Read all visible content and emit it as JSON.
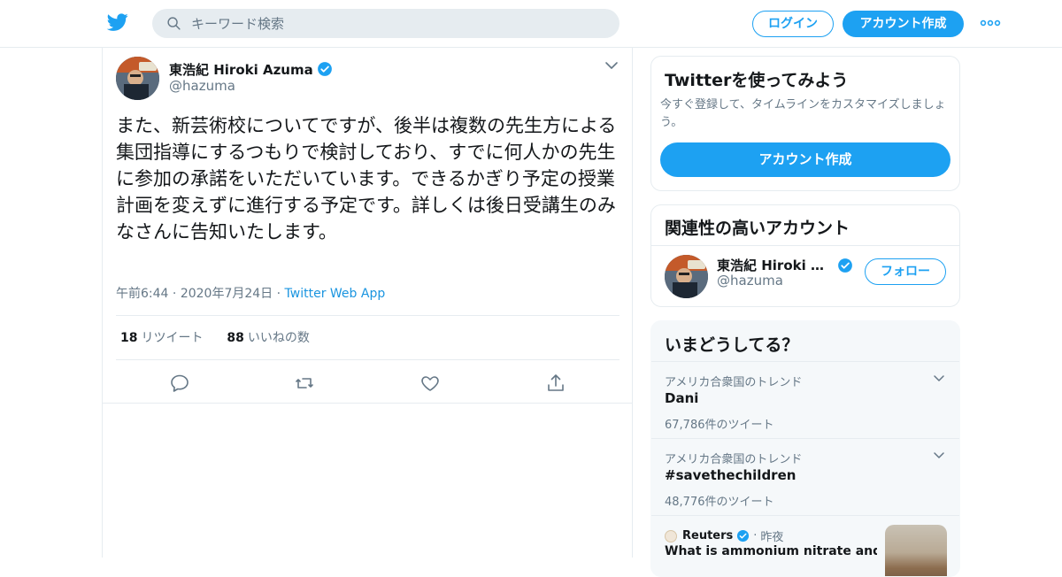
{
  "header": {
    "search_placeholder": "キーワード検索",
    "login_label": "ログイン",
    "signup_label": "アカウント作成"
  },
  "tweet": {
    "author_name": "東浩紀 Hiroki Azuma",
    "author_handle": "@hazuma",
    "text": "また、新芸術校についてですが、後半は複数の先生方による集団指導にするつもりで検討しており、すでに何人かの先生に参加の承諾をいただいています。できるかぎり予定の授業計画を変えずに進行する予定です。詳しくは後日受講生のみなさんに告知いたします。",
    "time": "午前6:44",
    "date": "2020年7月24日",
    "app": "Twitter Web App",
    "retweets_count": "18",
    "retweets_label": "リツイート",
    "likes_count": "88",
    "likes_label": "いいねの数"
  },
  "sidebar": {
    "signup_card": {
      "title": "Twitterを使ってみよう",
      "subtitle": "今すぐ登録して、タイムラインをカスタマイズしましょう。",
      "button": "アカウント作成"
    },
    "related": {
      "title": "関連性の高いアカウント",
      "name": "東浩紀 Hiroki Azu...",
      "handle": "@hazuma",
      "follow_label": "フォロー"
    },
    "trends": {
      "title": "いまどうしてる？",
      "items": [
        {
          "context": "アメリカ合衆国のトレンド",
          "topic": "Dani",
          "count": "67,786件のツイート"
        },
        {
          "context": "アメリカ合衆国のトレンド",
          "topic": "#savethechildren",
          "count": "48,776件のツイート"
        }
      ],
      "news": {
        "source": "Reuters",
        "time": "昨夜",
        "headline": "What is ammonium nitrate and why"
      }
    }
  },
  "colors": {
    "brand": "#1da1f2",
    "text": "#14171a",
    "muted": "#657786",
    "border": "#e6ecf0"
  },
  "icons": [
    "twitter-bird-icon",
    "search-icon",
    "more-dots-icon",
    "verified-badge-icon",
    "chevron-down-icon",
    "reply-icon",
    "retweet-icon",
    "like-icon",
    "share-icon"
  ]
}
